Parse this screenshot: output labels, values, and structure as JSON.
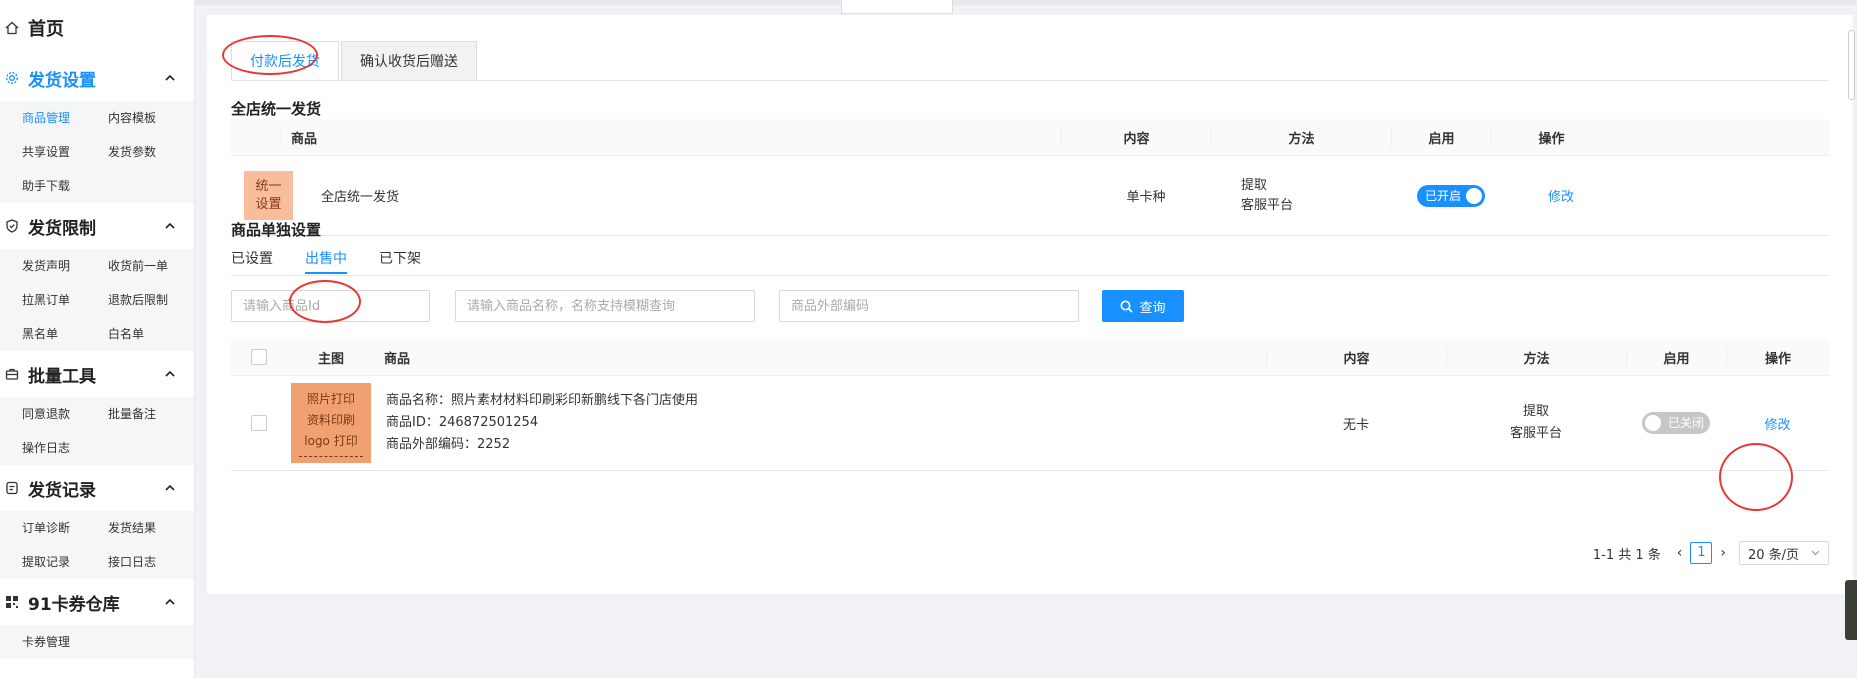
{
  "sidebar": {
    "home": "首页",
    "groups": [
      {
        "title": "发货设置",
        "active": true,
        "items": [
          "商品管理",
          "内容模板",
          "共享设置",
          "发货参数",
          "助手下载"
        ]
      },
      {
        "title": "发货限制",
        "items": [
          "发货声明",
          "收货前一单",
          "拉黑订单",
          "退款后限制",
          "黑名单",
          "白名单"
        ]
      },
      {
        "title": "批量工具",
        "items": [
          "同意退款",
          "批量备注",
          "操作日志"
        ]
      },
      {
        "title": "发货记录",
        "items": [
          "订单诊断",
          "发货结果",
          "提取记录",
          "接口日志"
        ]
      },
      {
        "title": "91卡券仓库",
        "items": [
          "卡券管理"
        ]
      }
    ]
  },
  "tabs": [
    "付款后发货",
    "确认收货后赠送"
  ],
  "section1": {
    "title": "全店统一发货",
    "headers": {
      "product": "商品",
      "content": "内容",
      "method": "方法",
      "enable": "启用",
      "action": "操作"
    },
    "row": {
      "thumb_line1": "统一",
      "thumb_line2": "设置",
      "name": "全店统一发货",
      "content": "单卡种",
      "method_line1": "提取",
      "method_line2": "客服平台",
      "toggle": "已开启",
      "action": "修改"
    }
  },
  "section2": {
    "title": "商品单独设置",
    "sub_tabs": [
      "已设置",
      "出售中",
      "已下架"
    ],
    "search": {
      "id_placeholder": "请输入商品Id",
      "name_placeholder": "请输入商品名称，名称支持模糊查询",
      "code_placeholder": "商品外部编码",
      "query_label": "查询"
    },
    "headers": {
      "image": "主图",
      "product": "商品",
      "content": "内容",
      "method": "方法",
      "enable": "启用",
      "action": "操作"
    },
    "row": {
      "img_line1": "照片打印",
      "img_line2": "资料印刷",
      "img_line3": "logo 打印",
      "name": "商品名称：照片素材材料印刷彩印新鹏线下各门店使用",
      "id": "商品ID：246872501254",
      "code": "商品外部编码：2252",
      "content": "无卡",
      "method_line1": "提取",
      "method_line2": "客服平台",
      "toggle": "已关闭",
      "action": "修改"
    },
    "pagination": {
      "summary": "1-1 共 1 条",
      "current": "1",
      "page_size": "20 条/页"
    }
  },
  "colors": {
    "accent": "#1890ff",
    "annotation": "#e53935"
  }
}
